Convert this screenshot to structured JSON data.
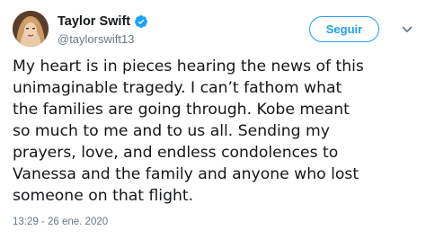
{
  "author": {
    "display_name": "Taylor Swift",
    "handle": "@taylorswift13",
    "verified": true
  },
  "follow_button": {
    "label": "Seguir"
  },
  "tweet": {
    "text": "My heart is in pieces hearing the news of this\nunimaginable tragedy. I can’t fathom what\nthe families are going through. Kobe meant\nso much to me and to us all. Sending my\nprayers, love, and endless condolences to\nVanessa and the family and anyone who lost\nsomeone on that flight.",
    "timestamp": "13:29 - 26 ene. 2020"
  },
  "icons": {
    "verified": "verified-badge-icon",
    "menu": "chevron-down-icon"
  },
  "colors": {
    "accent": "#1da1f2",
    "text": "#14171a",
    "secondary": "#657786"
  }
}
